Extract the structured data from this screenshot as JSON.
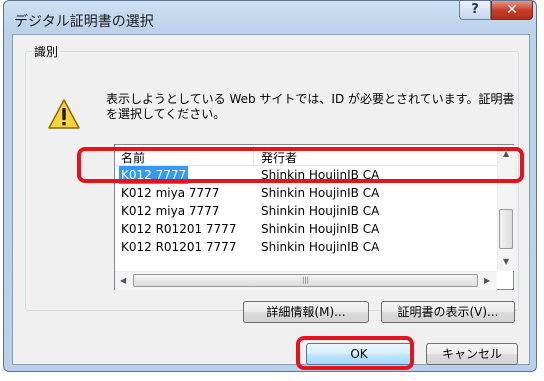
{
  "window": {
    "title": "デジタル証明書の選択",
    "help_glyph": "?",
    "close_glyph": "✕"
  },
  "group": {
    "label": "識別",
    "message": "表示しようとしている Web サイトでは、ID が必要とされています。証明書を選択してください。"
  },
  "table": {
    "columns": [
      "名前",
      "発行者"
    ],
    "rows": [
      {
        "name": "K012 7777",
        "issuer": "Shinkin HoujinIB CA"
      },
      {
        "name": "K012 miya 7777",
        "issuer": "Shinkin HoujinIB CA"
      },
      {
        "name": "K012 miya 7777",
        "issuer": "Shinkin HoujinIB CA"
      },
      {
        "name": "K012 R01201 7777",
        "issuer": "Shinkin HoujinIB CA"
      },
      {
        "name": "K012 R01201 7777",
        "issuer": "Shinkin HoujinIB CA"
      }
    ],
    "selected_index": 0
  },
  "buttons": {
    "details": "詳細情報(M)...",
    "view_cert": "証明書の表示(V)...",
    "ok": "OK",
    "cancel": "キャンセル"
  },
  "colors": {
    "selection": "#3399ff",
    "highlight": "#e8121e"
  }
}
